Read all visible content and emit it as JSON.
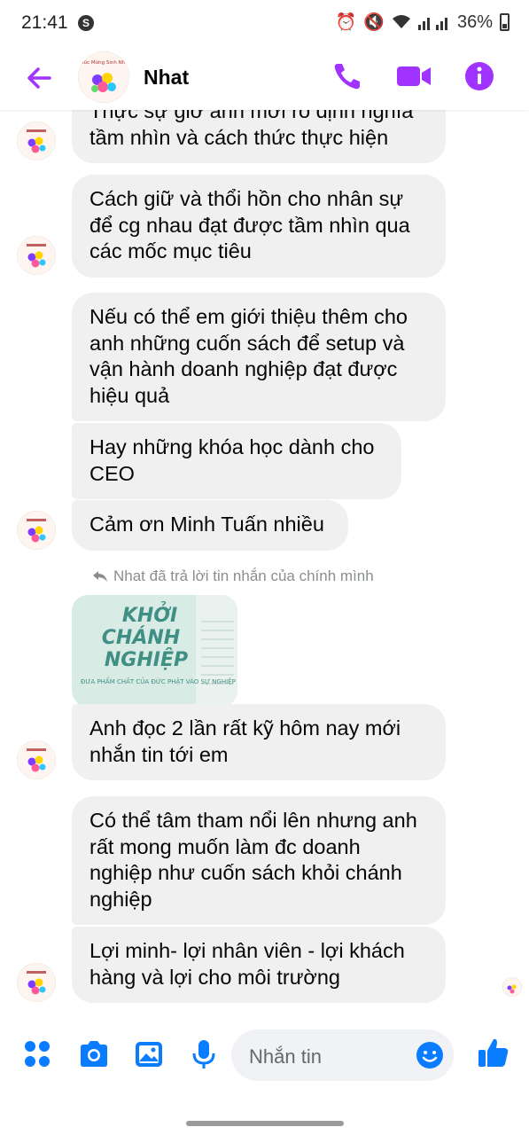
{
  "status_bar": {
    "time": "21:41",
    "battery": "36%"
  },
  "header": {
    "contact_name": "Nhat"
  },
  "messages": [
    {
      "text": "Thực sự giờ anh mới rõ định nghĩa tầm nhìn và cách thức thực hiện"
    },
    {
      "text": "Cách giữ và thổi hồn cho nhân sự để cg nhau đạt được tầm nhìn qua các mốc mục tiêu"
    },
    {
      "text": "Nếu có thể em giới thiệu thêm cho anh những cuốn sách để setup và vận hành doanh nghiệp đạt được hiệu quả"
    },
    {
      "text": "Hay những khóa học dành cho CEO"
    },
    {
      "text": "Cảm ơn Minh Tuấn nhiều"
    },
    {
      "text": "Anh đọc 2 lần rất kỹ hôm nay mới nhắn tin tới em"
    },
    {
      "text": "Có thể tâm tham nổi lên nhưng anh rất mong muốn làm đc doanh nghiệp như cuốn sách khỏi chánh nghiệp"
    },
    {
      "text": "Lợi minh- lợi nhân viên - lợi khách hàng và lợi cho môi trường"
    }
  ],
  "reply_note": "Nhat đã trả lời tin nhắn của chính mình",
  "reply_image": {
    "title_line1": "KHỞI",
    "title_line2": "CHÁNH",
    "title_line3": "NGHIỆP",
    "subtitle": "ĐƯA PHẨM CHẤT CỦA ĐỨC PHẬT VÀO SỰ NGHIỆP"
  },
  "composer": {
    "placeholder": "Nhắn tin"
  },
  "colors": {
    "accent": "#a033ff",
    "composer_blue": "#0a7cff",
    "bubble": "#f0f0f0"
  }
}
